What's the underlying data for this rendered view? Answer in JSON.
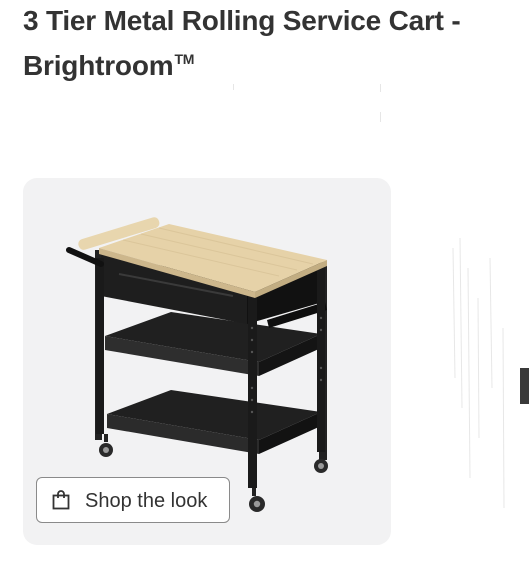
{
  "product": {
    "title_line1": "3 Tier Metal Rolling Service Cart -",
    "title_line2": "Brightroom",
    "trademark": "TM"
  },
  "gallery": {
    "shop_the_look_label": "Shop the look",
    "shop_icon": "shopping-bag-icon",
    "colors": {
      "card_background": "#f2f2f3",
      "cart_frame": "#1a1a1a",
      "butcher_block": "#e6d2a8"
    }
  }
}
